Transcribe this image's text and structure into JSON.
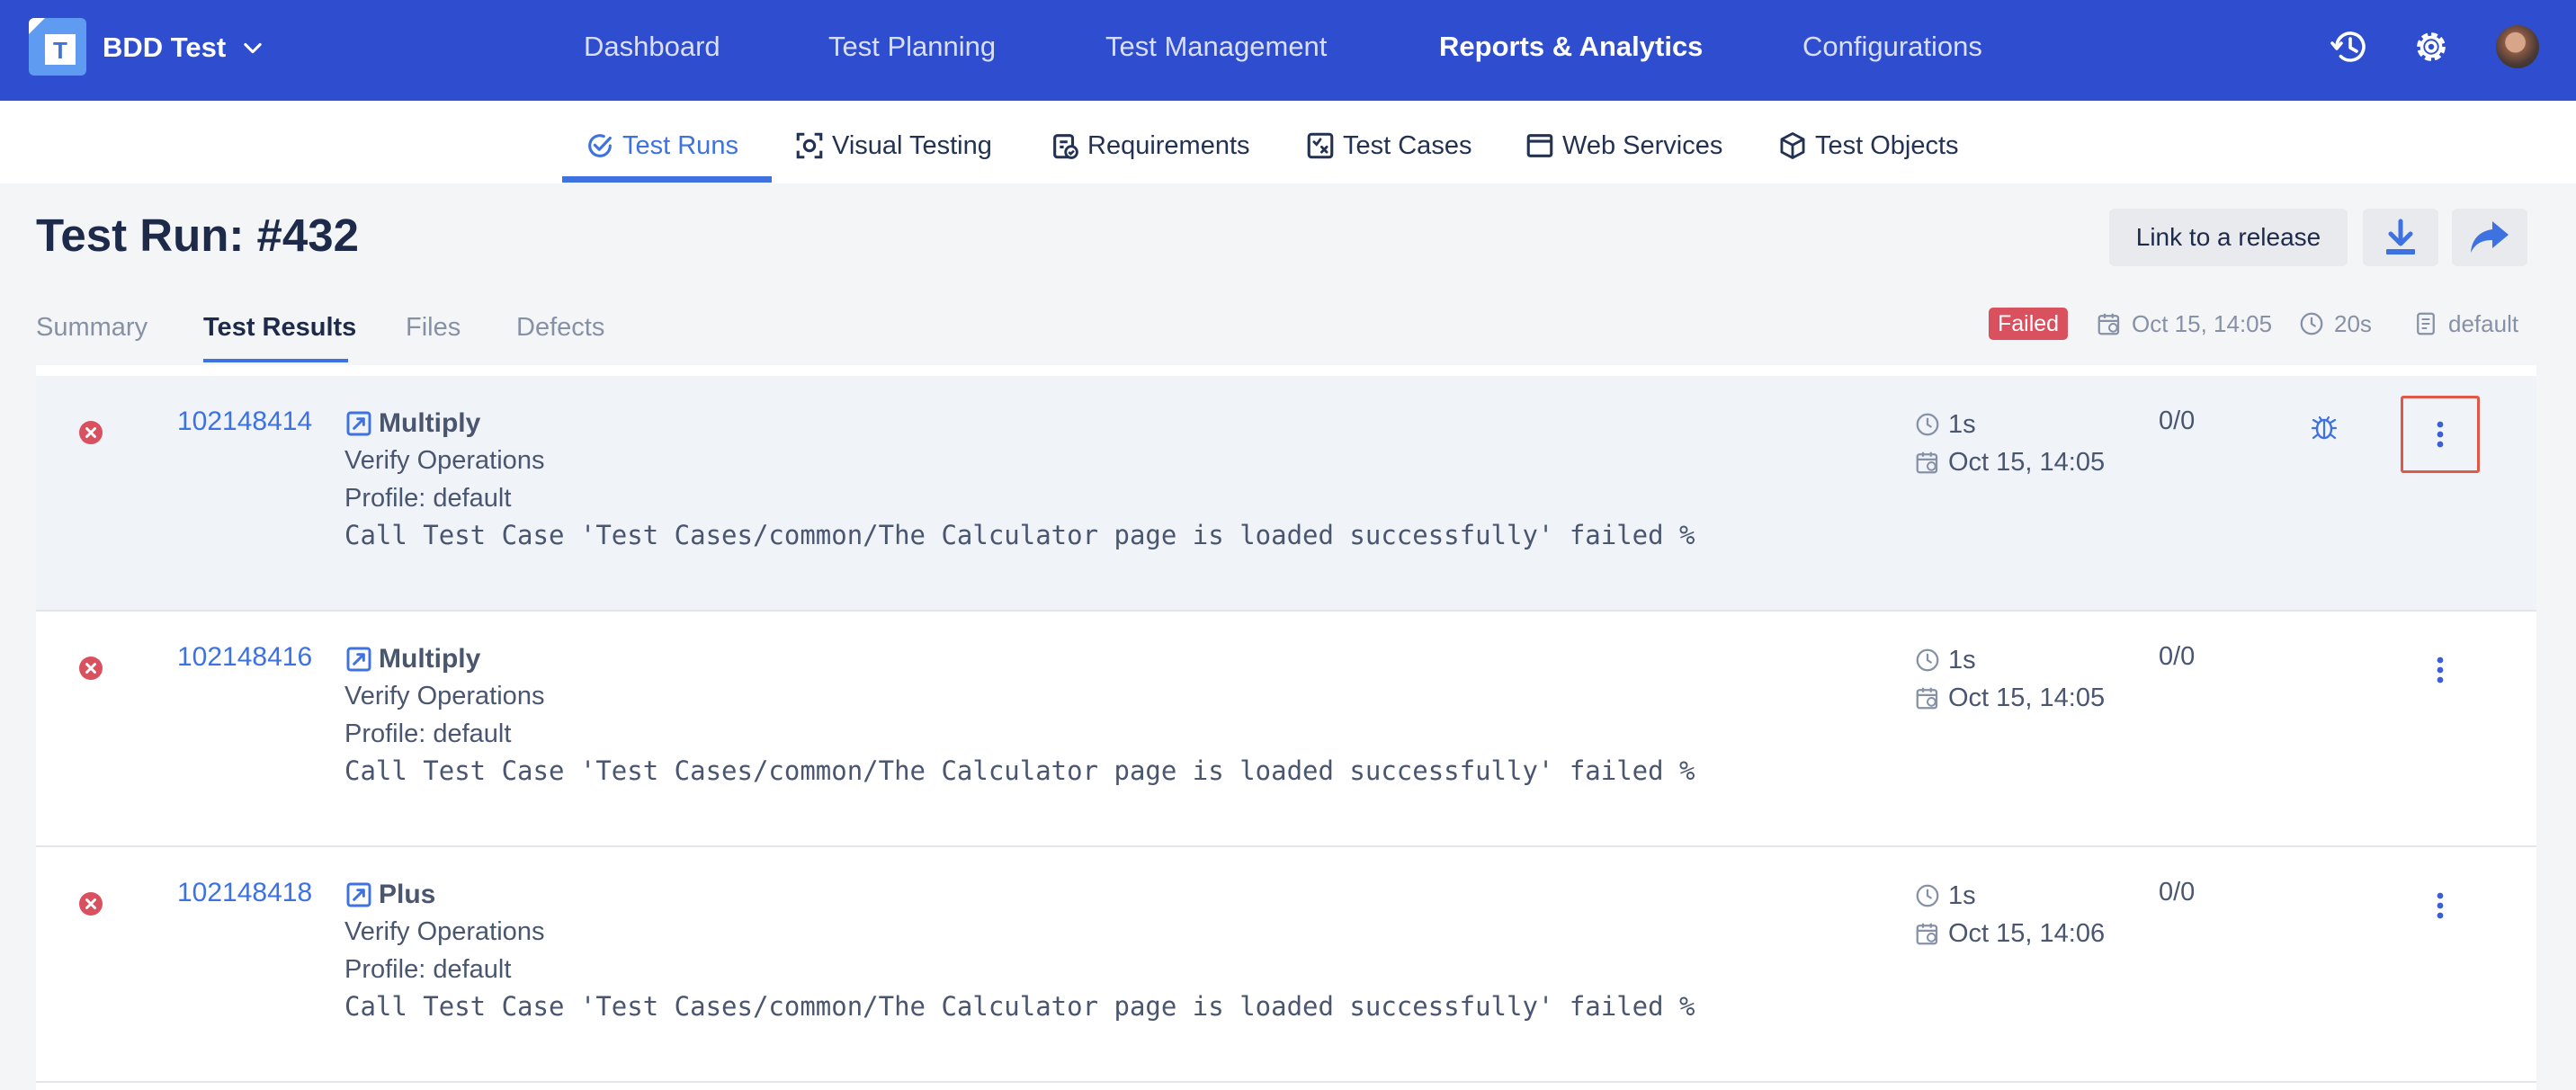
{
  "app": {
    "project_name": "BDD Test"
  },
  "main_nav": [
    "Dashboard",
    "Test Planning",
    "Test Management",
    "Reports & Analytics",
    "Configurations"
  ],
  "sub_nav": [
    "Test Runs",
    "Visual Testing",
    "Requirements",
    "Test Cases",
    "Web Services",
    "Test Objects"
  ],
  "page": {
    "title": "Test Run: #432",
    "link_button": "Link to a release"
  },
  "tabs": [
    "Summary",
    "Test Results",
    "Files",
    "Defects"
  ],
  "run_meta": {
    "status": "Failed",
    "date": "Oct 15, 14:05",
    "duration": "20s",
    "profile": "default"
  },
  "results": [
    {
      "id": "102148414",
      "name": "Multiply",
      "suite": "Verify Operations",
      "profile": "Profile: default",
      "error": "Call Test Case 'Test Cases/common/The Calculator page is loaded successfully' failed %",
      "duration": "1s",
      "date": "Oct 15, 14:05",
      "ratio": "0/0"
    },
    {
      "id": "102148416",
      "name": "Multiply",
      "suite": "Verify Operations",
      "profile": "Profile: default",
      "error": "Call Test Case 'Test Cases/common/The Calculator page is loaded successfully' failed %",
      "duration": "1s",
      "date": "Oct 15, 14:05",
      "ratio": "0/0"
    },
    {
      "id": "102148418",
      "name": "Plus",
      "suite": "Verify Operations",
      "profile": "Profile: default",
      "error": "Call Test Case 'Test Cases/common/The Calculator page is loaded successfully' failed %",
      "duration": "1s",
      "date": "Oct 15, 14:06",
      "ratio": "0/0"
    }
  ],
  "colors": {
    "topbar": "#2f4dcf",
    "accent": "#3d72e0",
    "failed": "#d9505f",
    "highlight_box": "#e05847"
  },
  "icons": {
    "topbar": [
      "logo-icon",
      "chevron-down-icon",
      "history-icon",
      "gear-icon",
      "avatar"
    ],
    "sub_nav": [
      "check-circle-icon",
      "camera-frame-icon",
      "clipboard-check-icon",
      "test-case-icon",
      "window-icon",
      "cube-icon"
    ],
    "row": [
      "fail-circle-icon",
      "external-link-icon",
      "clock-icon",
      "calendar-icon",
      "bug-icon",
      "more-vertical-icon"
    ]
  }
}
